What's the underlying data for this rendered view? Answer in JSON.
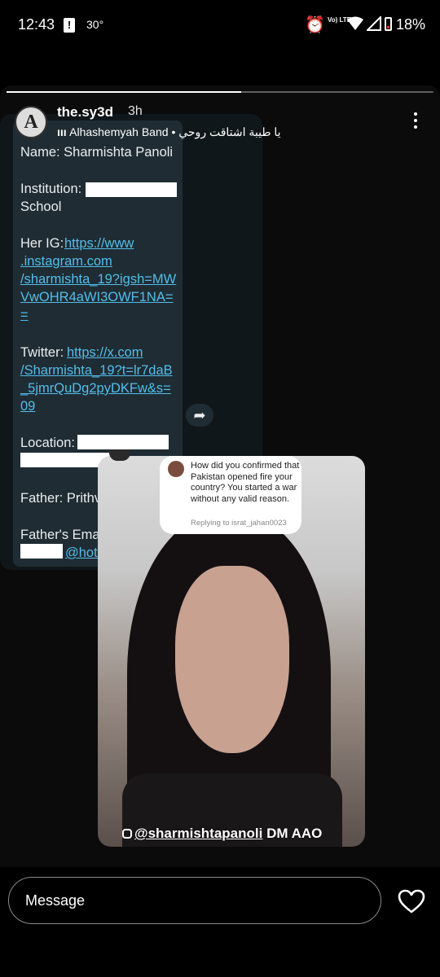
{
  "status_bar": {
    "time": "12:43",
    "alert_glyph": "!",
    "temperature": "30°",
    "network": "Vo) LTE",
    "battery": "18%"
  },
  "story": {
    "progress": 0.55,
    "username": "the.sy3d",
    "time_ago": "3h",
    "music": "Alhashemyah Band",
    "music_separator": "•",
    "song": "يا طيبة اشتاقت روحي",
    "more_icon": "more-vertical-icon"
  },
  "screenshot": {
    "lines": [
      "Name: Sharmishta Panoli",
      "Institution:",
      "School",
      "Her IG:",
      "https://www",
      ".instagram.com",
      "/sharmishta_19?igsh=MW",
      "VwOHR4aWI3OWF1NA=",
      "=",
      "Twitter:",
      "https://x.com",
      "/Sharmishta_19?t=lr7daB",
      "_5jmrQuDg2pyDKFw&s=",
      "09",
      "Location:",
      "Father: Prithv",
      "Father's Ema",
      "@hotr"
    ]
  },
  "video": {
    "dm_text": "How did you confirmed that Pakistan opened fire your country?  You started a war without any valid reason.",
    "dm_reply": "Replying to israt_jahan0023",
    "caption_handle": "@sharmishtapanoli",
    "caption_rest": "DM AAO"
  },
  "footer": {
    "message_placeholder": "Message",
    "heart_icon": "heart-outline-icon"
  }
}
